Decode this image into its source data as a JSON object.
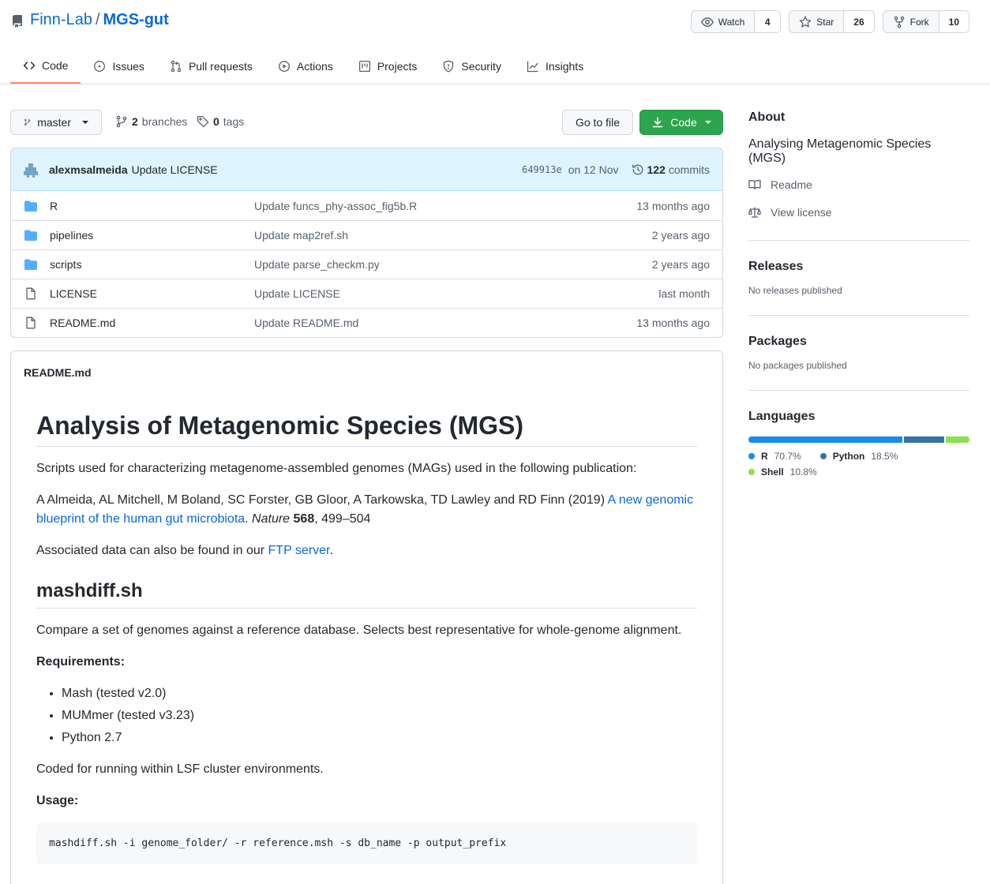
{
  "repo": {
    "owner": "Finn-Lab",
    "separator": "/",
    "name": "MGS-gut"
  },
  "actions": [
    {
      "label": "Watch",
      "count": "4",
      "icon": "eye-icon"
    },
    {
      "label": "Star",
      "count": "26",
      "icon": "star-icon"
    },
    {
      "label": "Fork",
      "count": "10",
      "icon": "fork-icon"
    }
  ],
  "tabs": [
    {
      "label": "Code",
      "icon": "code-icon",
      "active": true
    },
    {
      "label": "Issues",
      "icon": "issue-icon"
    },
    {
      "label": "Pull requests",
      "icon": "pull-request-icon"
    },
    {
      "label": "Actions",
      "icon": "play-icon"
    },
    {
      "label": "Projects",
      "icon": "project-icon"
    },
    {
      "label": "Security",
      "icon": "shield-icon"
    },
    {
      "label": "Insights",
      "icon": "graph-icon"
    }
  ],
  "toolbar": {
    "branch": "master",
    "branches_count": "2",
    "branches_label": "branches",
    "tags_count": "0",
    "tags_label": "tags",
    "goto_label": "Go to file",
    "code_label": "Code"
  },
  "commit": {
    "author": "alexmsalmeida",
    "message": "Update LICENSE",
    "sha": "649913e",
    "date": "on 12 Nov",
    "count": "122",
    "count_label": "commits"
  },
  "files": [
    {
      "type": "folder",
      "name": "R",
      "message": "Update funcs_phy-assoc_fig5b.R",
      "age": "13 months ago"
    },
    {
      "type": "folder",
      "name": "pipelines",
      "message": "Update map2ref.sh",
      "age": "2 years ago"
    },
    {
      "type": "folder",
      "name": "scripts",
      "message": "Update parse_checkm.py",
      "age": "2 years ago"
    },
    {
      "type": "file",
      "name": "LICENSE",
      "message": "Update LICENSE",
      "age": "last month"
    },
    {
      "type": "file",
      "name": "README.md",
      "message": "Update README.md",
      "age": "13 months ago"
    }
  ],
  "readme": {
    "filename": "README.md",
    "h1": "Analysis of Metagenomic Species (MGS)",
    "intro": "Scripts used for characterizing metagenome-assembled genomes (MAGs) used in the following publication:",
    "citation_authors": "A Almeida, AL Mitchell, M Boland, SC Forster, GB Gloor, A Tarkowska, TD Lawley and RD Finn (2019) ",
    "citation_link": "A new genomic blueprint of the human gut microbiota",
    "citation_period": ". ",
    "citation_journal": "Nature",
    "citation_volume": "568",
    "citation_pages": ", 499–504",
    "data_text": "Associated data can also be found in our ",
    "data_link": "FTP server",
    "data_end": ".",
    "h2": "mashdiff.sh",
    "compare": "Compare a set of genomes against a reference database. Selects best representative for whole-genome alignment.",
    "requirements_label": "Requirements:",
    "requirements": [
      "Mash (tested v2.0)",
      "MUMmer (tested v3.23)",
      "Python 2.7"
    ],
    "cluster": "Coded for running within LSF cluster environments.",
    "usage_label": "Usage:",
    "usage_code": "mashdiff.sh -i genome_folder/ -r reference.msh -s db_name -p output_prefix"
  },
  "sidebar": {
    "about_title": "About",
    "about_desc": "Analysing Metagenomic Species (MGS)",
    "readme_link": "Readme",
    "license_link": "View license",
    "releases_title": "Releases",
    "releases_text": "No releases published",
    "packages_title": "Packages",
    "packages_text": "No packages published",
    "languages_title": "Languages",
    "languages": [
      {
        "name": "R",
        "pct": "70.7%",
        "value": 70.7,
        "color": "#198ce7"
      },
      {
        "name": "Python",
        "pct": "18.5%",
        "value": 18.5,
        "color": "#3572a5"
      },
      {
        "name": "Shell",
        "pct": "10.8%",
        "value": 10.8,
        "color": "#89e051"
      }
    ]
  }
}
